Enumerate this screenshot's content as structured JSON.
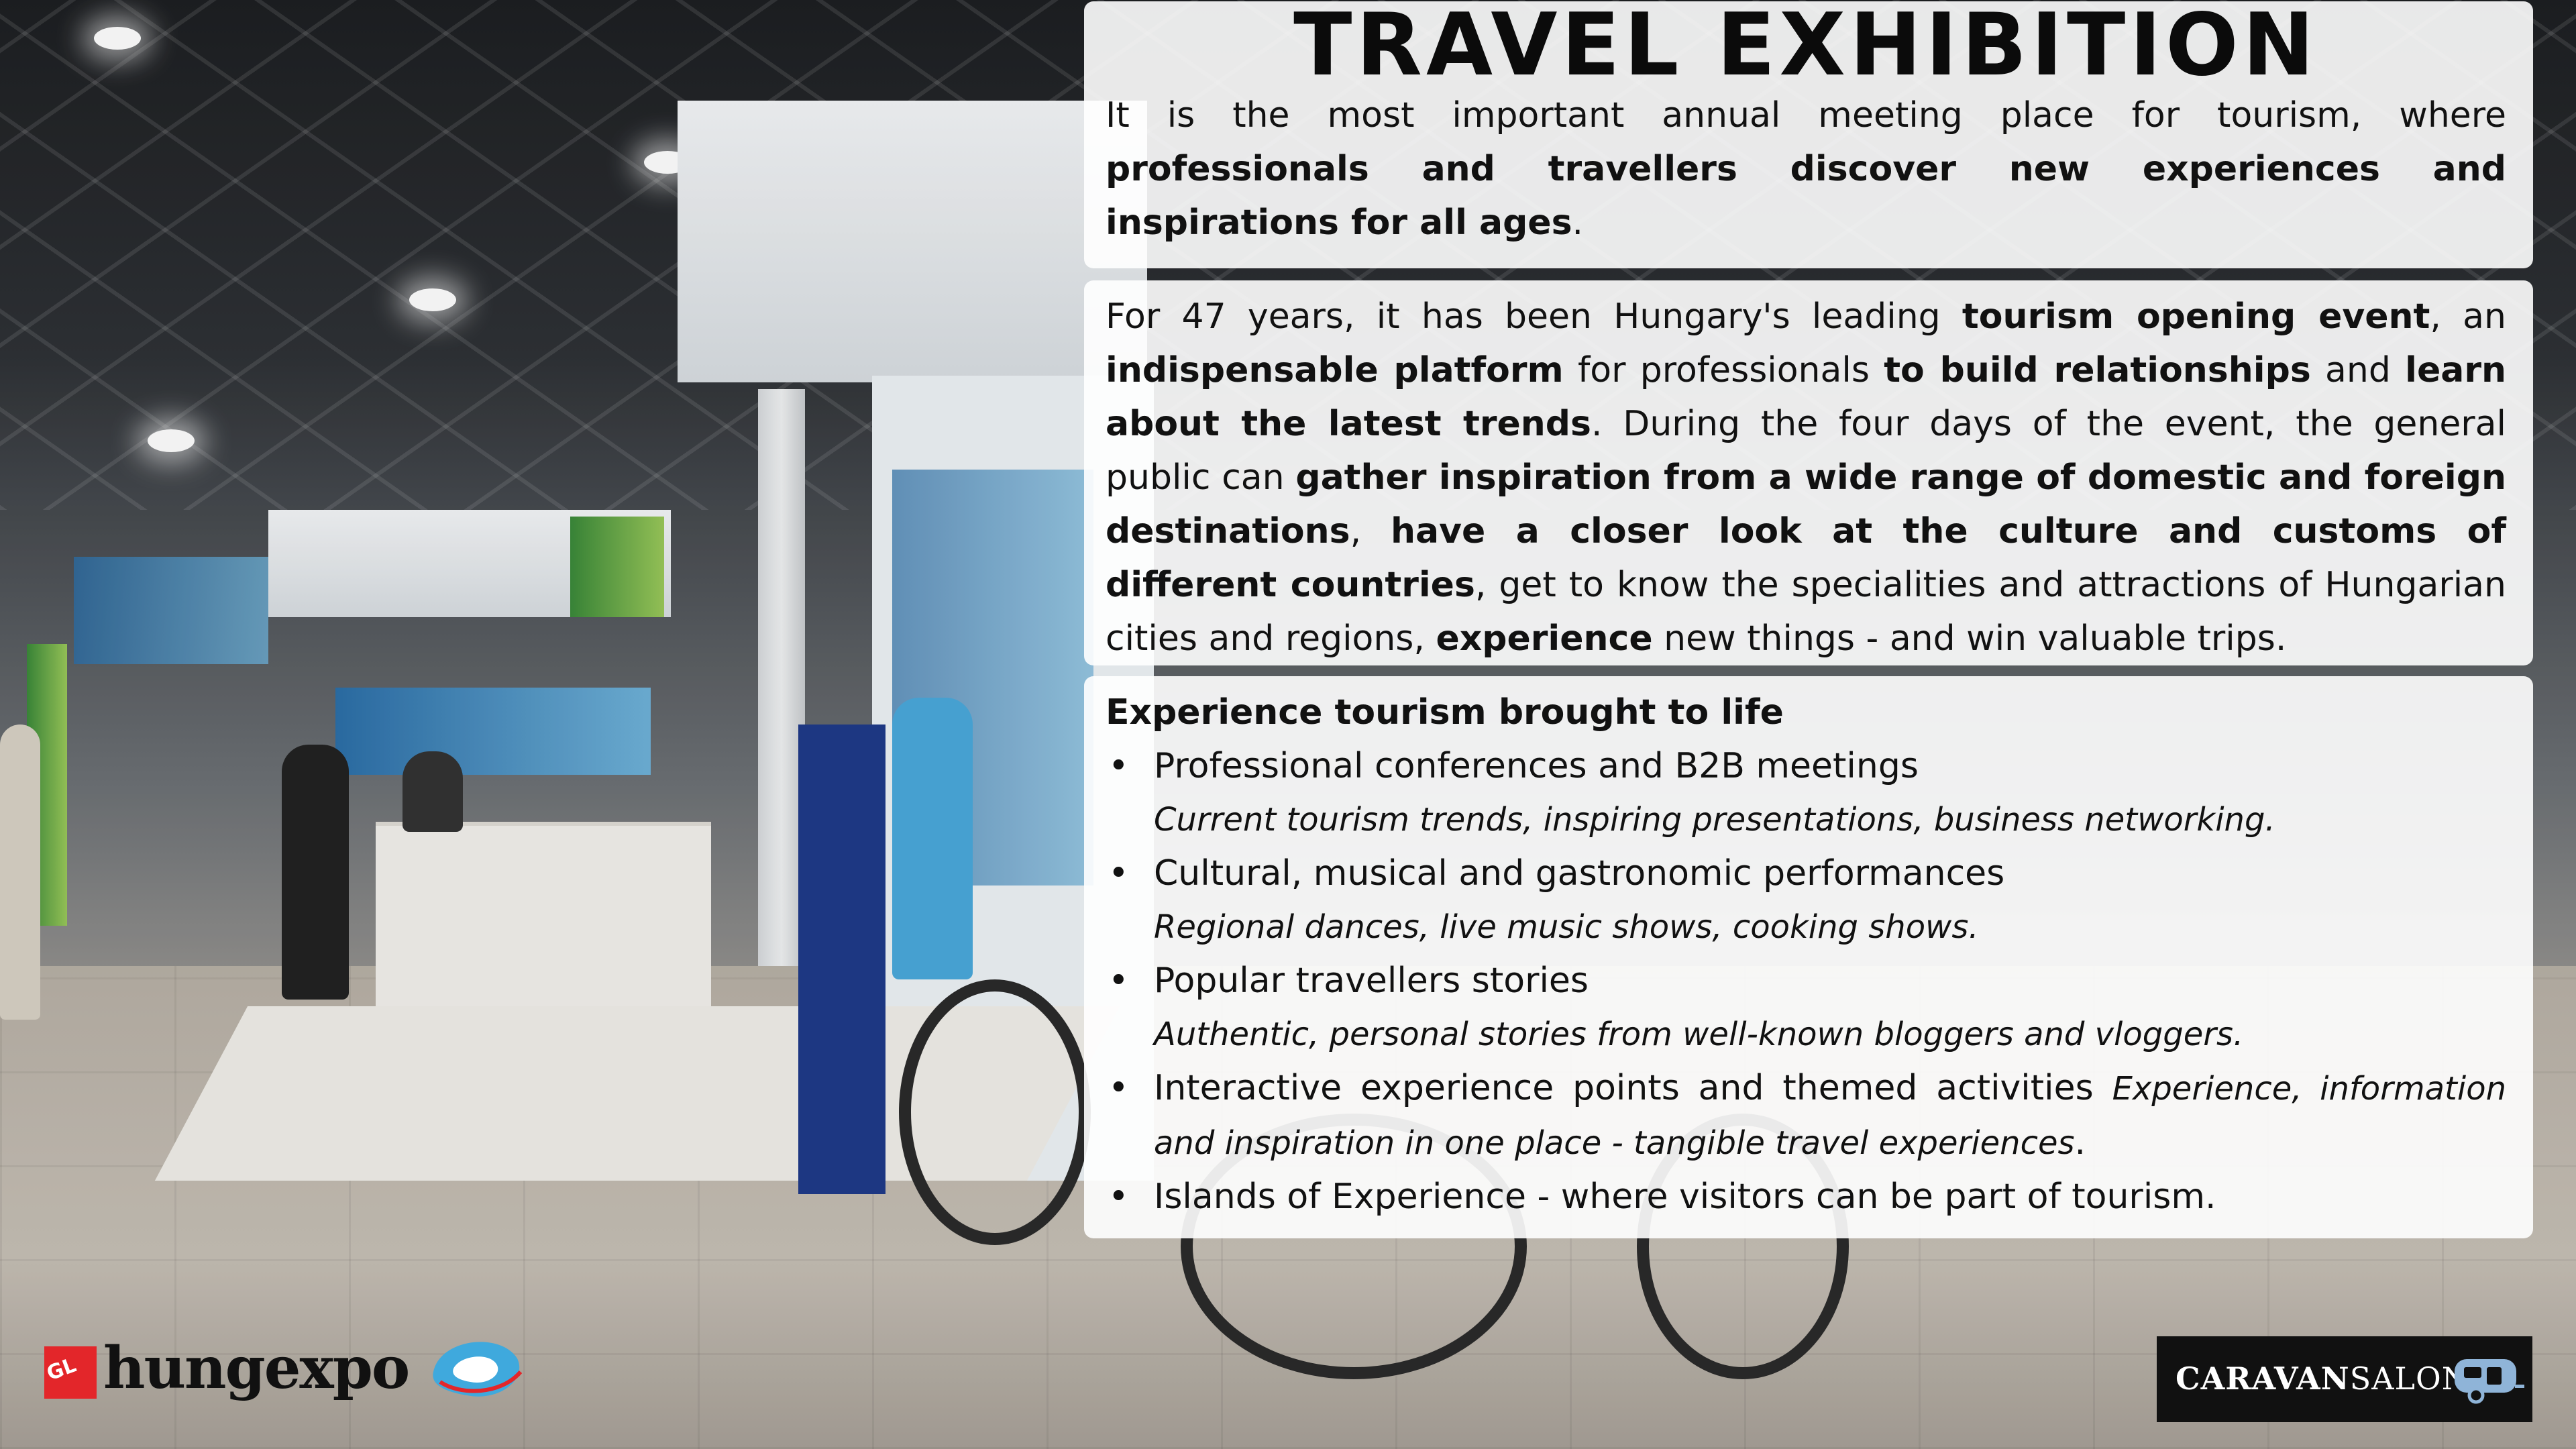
{
  "title": "TRAVEL EXHIBITION",
  "intro": {
    "plain1": "It is the most important annual meeting place for tourism, where ",
    "bold1": "professionals and travellers discover new experiences and inspirations for all ages",
    "plain2": "."
  },
  "about": {
    "t1": "For 47 years, it has been Hungary's leading ",
    "b1": "tourism opening event",
    "t2": ", an ",
    "b2": "indispensable platform",
    "t3": " for professionals ",
    "b3": "to build relationships",
    "t4": " and ",
    "b4": "learn about the latest trends",
    "t5": ". During the four days of the event, the general public can ",
    "b5": "gather inspiration from a wide range of domestic and foreign destinations",
    "t6": ", ",
    "b6": "have a closer look at the culture and customs of different countries",
    "t7": ", get to know the specialities and attractions of Hungarian cities and regions, ",
    "b7": "experience",
    "t8": " new things - and win valuable trips."
  },
  "experience": {
    "heading": "Experience tourism brought to life",
    "items": [
      {
        "label": "Professional conferences and B2B meetings",
        "detail": "Current tourism trends, inspiring presentations, business networking."
      },
      {
        "label": "Cultural, musical and gastronomic performances",
        "detail": "Regional dances, live music shows, cooking shows."
      },
      {
        "label": "Popular travellers stories",
        "detail": "Authentic, personal stories from well-known bloggers and vloggers."
      },
      {
        "label": "Interactive experience points and themed activities",
        "detail": "Experience, information and inspiration in one place - tangible travel experiences",
        "detail_end": "."
      },
      {
        "label": "Islands of Experience - where visitors can be part of tourism."
      }
    ]
  },
  "logos": {
    "gl": "GL events",
    "hungexpo": "hungexpo",
    "caravan_bold": "CARAVAN",
    "caravan_light": "SALON"
  },
  "colors": {
    "panel": "#ffffff",
    "gl_red": "#e3262a",
    "hungexpo_blue": "#3fa9dd",
    "caravan_bg": "#111111"
  }
}
